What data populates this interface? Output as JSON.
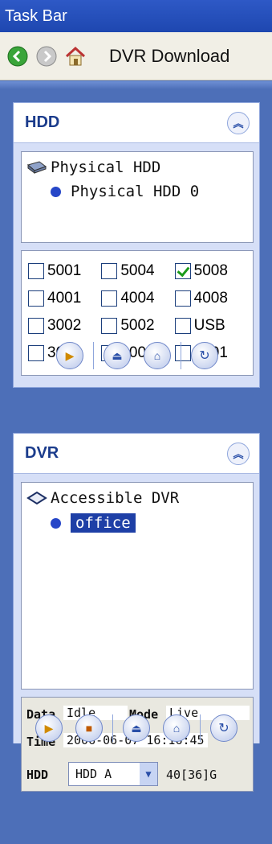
{
  "titlebar": {
    "title": "Task Bar"
  },
  "toolbar": {
    "title": "DVR Download",
    "icons": [
      "back-icon",
      "forward-icon",
      "home-icon"
    ]
  },
  "hdd_panel": {
    "title": "HDD",
    "tree": {
      "root": "Physical HDD",
      "child": "Physical HDD 0"
    },
    "checkboxes": [
      {
        "label": "5001",
        "checked": false
      },
      {
        "label": "5004",
        "checked": false
      },
      {
        "label": "5008",
        "checked": true
      },
      {
        "label": "4001",
        "checked": false
      },
      {
        "label": "4004",
        "checked": false
      },
      {
        "label": "4008",
        "checked": false
      },
      {
        "label": "3002",
        "checked": false
      },
      {
        "label": "5002",
        "checked": false
      },
      {
        "label": "USB",
        "checked": false
      },
      {
        "label": "3004",
        "checked": false
      },
      {
        "label": "2001A",
        "checked": false
      },
      {
        "label": "2001",
        "checked": false
      }
    ]
  },
  "dvr_panel": {
    "title": "DVR",
    "tree": {
      "root": "Accessible DVR",
      "child": "office"
    },
    "info": {
      "data_label": "Data",
      "data_value": "Idle",
      "mode_label": "Mode",
      "mode_value": "Live",
      "time_label": "Time",
      "time_value": "2006-06-07 16:16:45",
      "hdd_label": "HDD",
      "hdd_select": "HDD A",
      "hdd_size": "40[36]G"
    }
  }
}
